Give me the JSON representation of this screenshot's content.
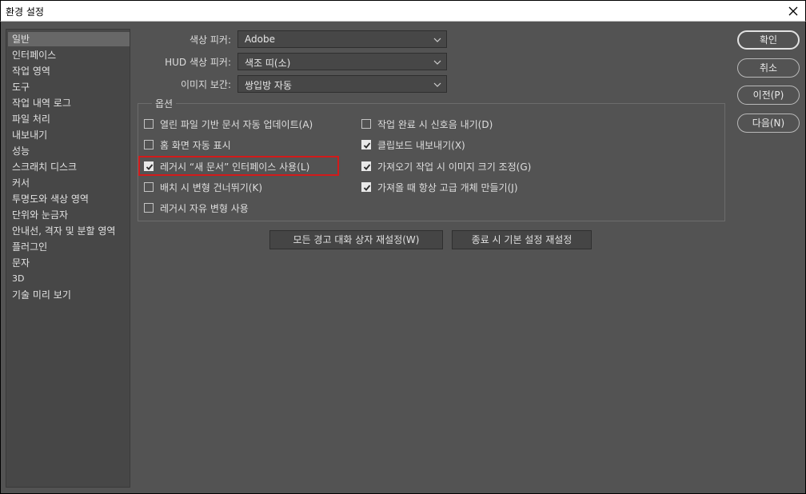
{
  "window": {
    "title": "환경 설정"
  },
  "sidebar": {
    "items": [
      {
        "label": "일반",
        "selected": true
      },
      {
        "label": "인터페이스"
      },
      {
        "label": "작업 영역"
      },
      {
        "label": "도구"
      },
      {
        "label": "작업 내역 로그"
      },
      {
        "label": "파일 처리"
      },
      {
        "label": "내보내기"
      },
      {
        "label": "성능"
      },
      {
        "label": "스크래치 디스크"
      },
      {
        "label": "커서"
      },
      {
        "label": "투명도와 색상 영역"
      },
      {
        "label": "단위와 눈금자"
      },
      {
        "label": "안내선, 격자 및 분할 영역"
      },
      {
        "label": "플러그인"
      },
      {
        "label": "문자"
      },
      {
        "label": "3D"
      },
      {
        "label": "기술 미리 보기"
      }
    ]
  },
  "settings": {
    "color_picker": {
      "label": "색상 피커:",
      "value": "Adobe"
    },
    "hud_picker": {
      "label": "HUD 색상 피커:",
      "value": "색조 띠(소)"
    },
    "interpolation": {
      "label": "이미지 보간:",
      "value": "쌍입방 자동"
    }
  },
  "options": {
    "legend": "옵션",
    "left": [
      {
        "label": "열린 파일 기반 문서 자동 업데이트(A)",
        "checked": false
      },
      {
        "label": "홈 화면 자동 표시",
        "checked": false
      },
      {
        "label": "레거시 “새 문서” 인터페이스 사용(L)",
        "checked": true,
        "highlighted": true
      },
      {
        "label": "배치 시 변형 건너뛰기(K)",
        "checked": false
      },
      {
        "label": "레거시 자유 변형 사용",
        "checked": false
      }
    ],
    "right": [
      {
        "label": "작업 완료 시 신호음 내기(D)",
        "checked": false
      },
      {
        "label": "클립보드 내보내기(X)",
        "checked": true
      },
      {
        "label": "가져오기 작업 시 이미지 크기 조정(G)",
        "checked": true
      },
      {
        "label": "가져올 때 항상 고급 개체 만들기(J)",
        "checked": true
      }
    ]
  },
  "actions": {
    "reset_warnings": "모든 경고 대화 상자 재설정(W)",
    "reset_on_quit": "종료 시 기본 설정 재설정"
  },
  "buttons": {
    "ok": "확인",
    "cancel": "취소",
    "prev": "이전(P)",
    "next": "다음(N)"
  },
  "colors": {
    "background": "#535353",
    "panel": "#474747",
    "highlight_border": "#d21a1a"
  }
}
